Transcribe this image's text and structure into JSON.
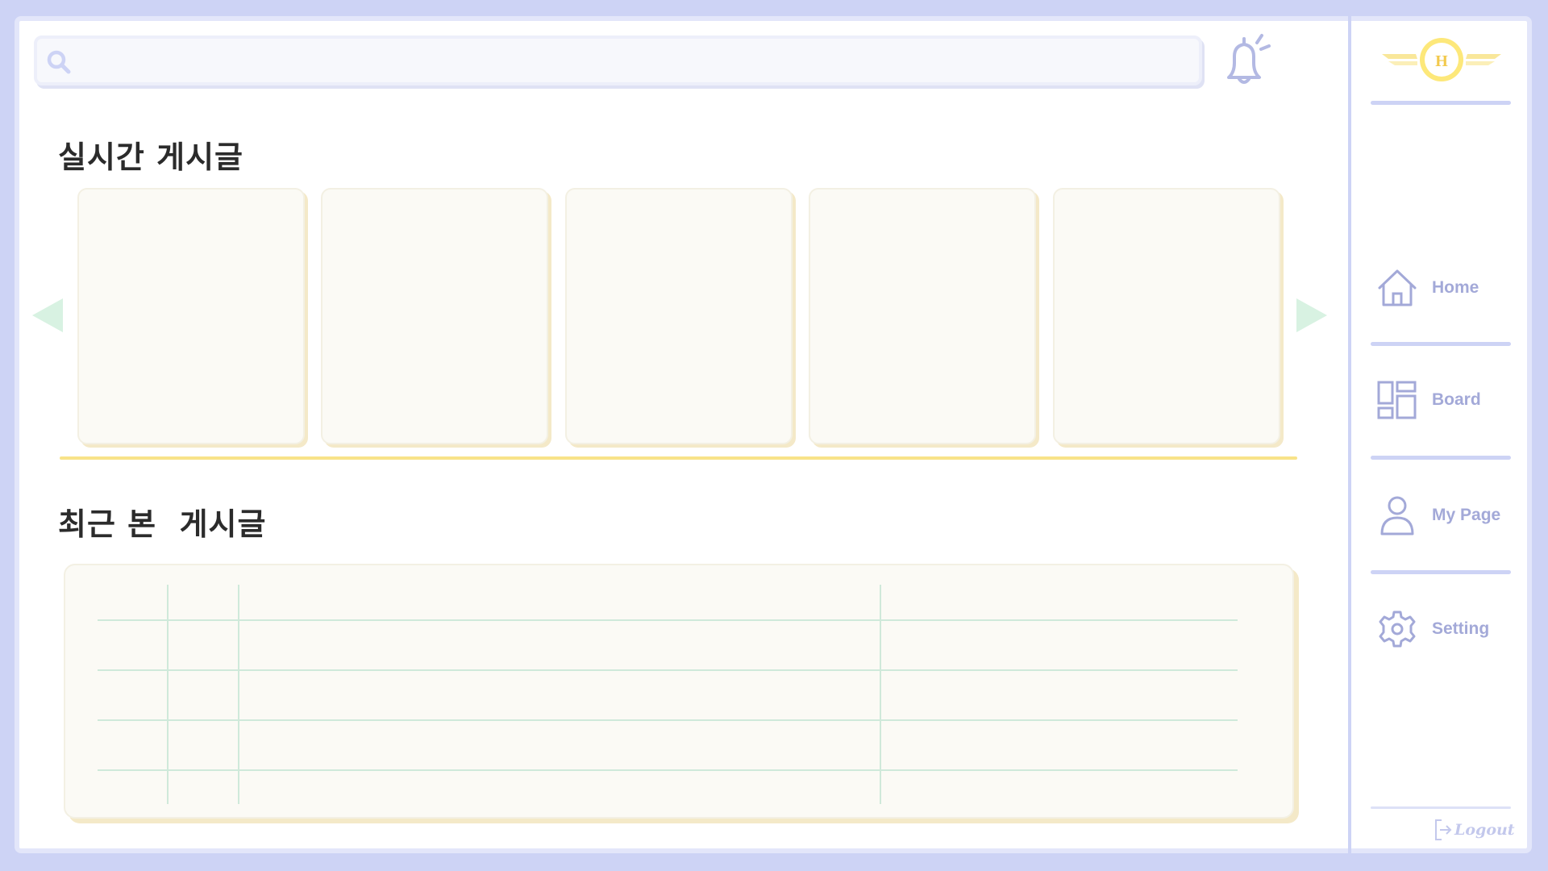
{
  "search": {
    "placeholder": "",
    "value": ""
  },
  "notifications": {
    "icon": "bell-icon"
  },
  "realtime": {
    "title": "실시간 게시글",
    "cards": [
      {},
      {},
      {},
      {},
      {}
    ]
  },
  "recent": {
    "title": "최근 본  게시글",
    "rows": [
      [],
      [],
      [],
      []
    ]
  },
  "sidebar": {
    "logo_letter": "H",
    "items": [
      {
        "label": "Home",
        "icon": "home-icon"
      },
      {
        "label": "Board",
        "icon": "board-icon"
      },
      {
        "label": "My Page",
        "icon": "user-icon"
      },
      {
        "label": "Setting",
        "icon": "gear-icon"
      }
    ],
    "logout_label": "Logout"
  },
  "colors": {
    "page_background": "#cdd3f5",
    "panel_background": "#fbfaf5",
    "nav_text": "#a3a9d8",
    "accent_yellow": "#f8e389",
    "arrow_green": "#d8f2e2",
    "grid_line": "#cfe9da"
  }
}
